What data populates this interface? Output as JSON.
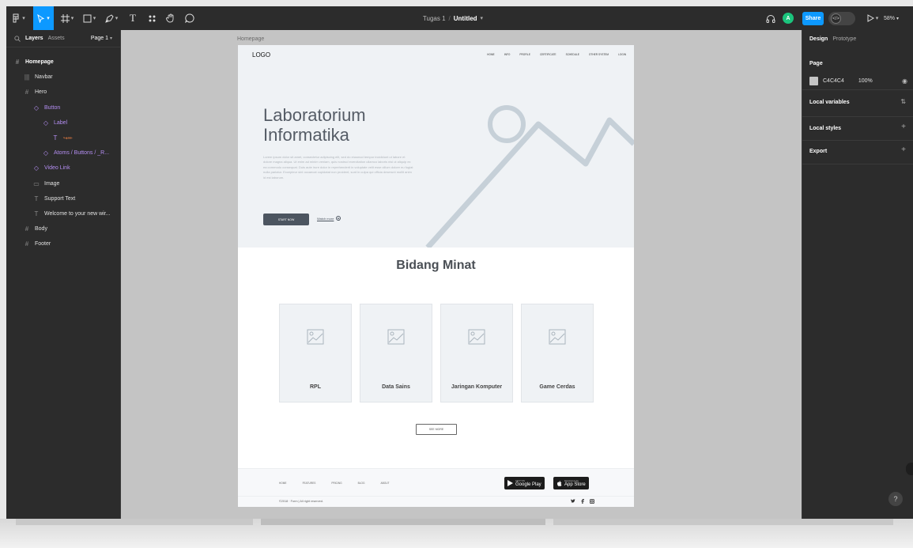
{
  "toolbar": {
    "project_name": "Tugas 1",
    "separator": "/",
    "file_name": "Untitled",
    "text_tool_glyph": "T",
    "avatar_initial": "A",
    "share_label": "Share",
    "dev_mode_glyph": "</>",
    "zoom": "58%",
    "icons": [
      "figma-menu-icon",
      "move-tool-icon",
      "frame-tool-icon",
      "shape-tool-icon",
      "pen-tool-icon",
      "text-tool-icon",
      "resources-icon",
      "hand-tool-icon",
      "comment-icon",
      "headphones-icon",
      "play-icon"
    ],
    "accent_color": "#0d99ff"
  },
  "left_panel": {
    "tabs": [
      "Layers",
      "Assets"
    ],
    "page_selector": "Page 1",
    "layers": [
      {
        "name": "Homepage",
        "indent": 0,
        "icon": "frame-icon",
        "glyph": "#",
        "component": false
      },
      {
        "name": "Navbar",
        "indent": 1,
        "icon": "auto-layout-icon",
        "glyph": "|||",
        "component": false
      },
      {
        "name": "Hero",
        "indent": 1,
        "icon": "frame-icon",
        "glyph": "#",
        "component": false
      },
      {
        "name": "Button",
        "indent": 2,
        "icon": "instance-icon",
        "glyph": "◇",
        "component": true
      },
      {
        "name": "Label",
        "indent": 3,
        "icon": "instance-icon",
        "glyph": "◇",
        "component": true
      },
      {
        "name": "↪✏",
        "indent": 4,
        "icon": "text-icon",
        "glyph": "T",
        "component": true
      },
      {
        "name": "Atoms / Buttons / _R...",
        "indent": 3,
        "icon": "instance-icon",
        "glyph": "◇",
        "component": true
      },
      {
        "name": "Video Link",
        "indent": 2,
        "icon": "instance-icon",
        "glyph": "◇",
        "component": true
      },
      {
        "name": "Image",
        "indent": 2,
        "icon": "image-icon",
        "glyph": "▭",
        "component": false
      },
      {
        "name": "Support Text",
        "indent": 2,
        "icon": "text-icon",
        "glyph": "T",
        "component": false
      },
      {
        "name": "Welcome to your new wir...",
        "indent": 2,
        "icon": "text-icon",
        "glyph": "T",
        "component": false
      },
      {
        "name": "Body",
        "indent": 1,
        "icon": "frame-icon",
        "glyph": "#",
        "component": false
      },
      {
        "name": "Footer",
        "indent": 1,
        "icon": "frame-icon",
        "glyph": "#",
        "component": false
      }
    ]
  },
  "right_panel": {
    "tabs": [
      "Design",
      "Prototype"
    ],
    "page_heading": "Page",
    "fill_hex": "C4C4C4",
    "fill_opacity": "100%",
    "fill_color": "#c4c4c4",
    "sections": [
      "Local variables",
      "Local styles",
      "Export"
    ],
    "help": "?"
  },
  "canvas": {
    "frame_label": "Homepage",
    "logo": "LOGO",
    "nav_links": [
      "HOME",
      "INFO",
      "PROFILE",
      "CERTIFICATE",
      "SCHEDULE",
      "OTHER SYSTEM",
      "LOGIN"
    ],
    "hero_title": "Laboratorium Informatika",
    "hero_text": "Lorem ipsum dolor sit amet, consectetur adipiscing elit, sed do eiusmod tempor incididunt ut labore et dolore magna aliqua. Ut enim ad minim veniam, quis nostrud exercitation ullamco laboris nisi ut aliquip ex ea commodo consequat. Duis aute irure dolor in reprehenderit in voluptate velit esse cillum dolore eu fugiat nulla pariatur. Excepteur sint occaecat cupidatat non proident, sunt in culpa qui officia deserunt mollit anim id est laborum.",
    "start_button": "START NOW",
    "watch_link": "Watch more",
    "section_title": "Bidang Minat",
    "cards": [
      "RPL",
      "Data Sains",
      "Jaringan Komputer",
      "Game Cerdas"
    ],
    "see_more": "SEE MORE",
    "footer_links": [
      "HOME",
      "FEATURES",
      "PRICING",
      "BLOG",
      "ABOUT"
    ],
    "google_play": {
      "small": "GET IT ON",
      "big": "Google Play"
    },
    "app_store": {
      "small": "Download on the",
      "big": "App Store"
    },
    "copyright": "©2018 · Form | All right reserved.",
    "socials": [
      "twitter-icon",
      "facebook-icon",
      "instagram-icon"
    ]
  }
}
